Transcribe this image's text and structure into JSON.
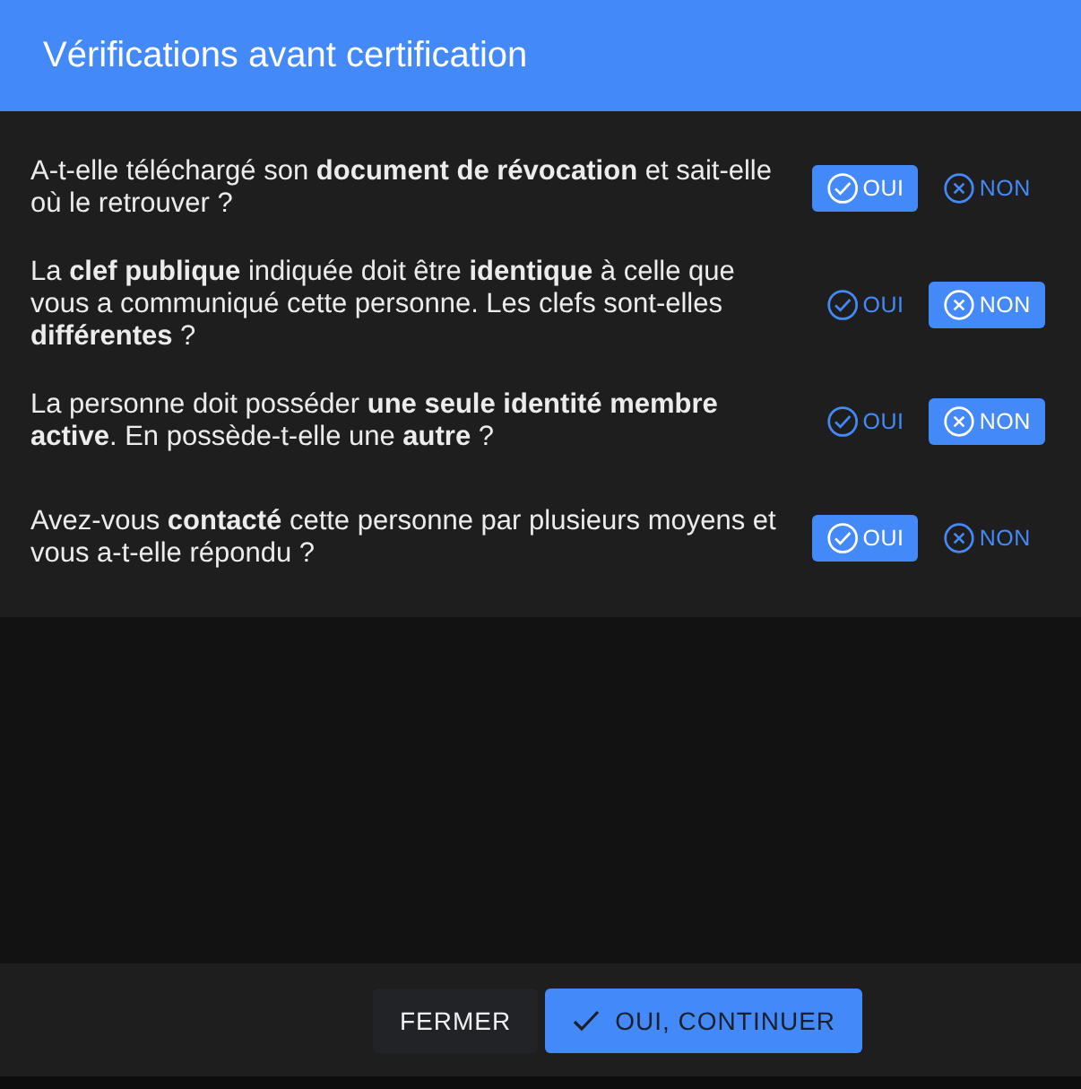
{
  "dialog": {
    "title": "Vérifications avant certification"
  },
  "questions": [
    {
      "text": "A-t-elle téléchargé son **document de révocation** et sait-elle où le retrouver ?",
      "options": [
        {
          "kind": "yes",
          "label": "OUI",
          "selected": true
        },
        {
          "kind": "no",
          "label": "NON",
          "selected": false
        }
      ]
    },
    {
      "text": "La **clef publique** indiquée doit être **identique** à celle que vous a communiqué cette personne. Les clefs sont-elles **différentes** ?",
      "options": [
        {
          "kind": "yes",
          "label": "OUI",
          "selected": false
        },
        {
          "kind": "no",
          "label": "NON",
          "selected": true
        }
      ]
    },
    {
      "text": "La personne doit posséder **une seule identité membre active**. En possède-t-elle une **autre** ?",
      "options": [
        {
          "kind": "yes",
          "label": "OUI",
          "selected": false
        },
        {
          "kind": "no",
          "label": "NON",
          "selected": true
        }
      ]
    },
    {
      "text": "Avez-vous **contacté** cette personne par plusieurs moyens et vous a-t-elle répondu ?",
      "options": [
        {
          "kind": "yes",
          "label": "OUI",
          "selected": true
        },
        {
          "kind": "no",
          "label": "NON",
          "selected": false
        }
      ]
    }
  ],
  "buttons": [
    {
      "kind": "close",
      "label": "FERMER"
    },
    {
      "kind": "confirm",
      "label": "OUI, CONTINUER"
    }
  ]
}
